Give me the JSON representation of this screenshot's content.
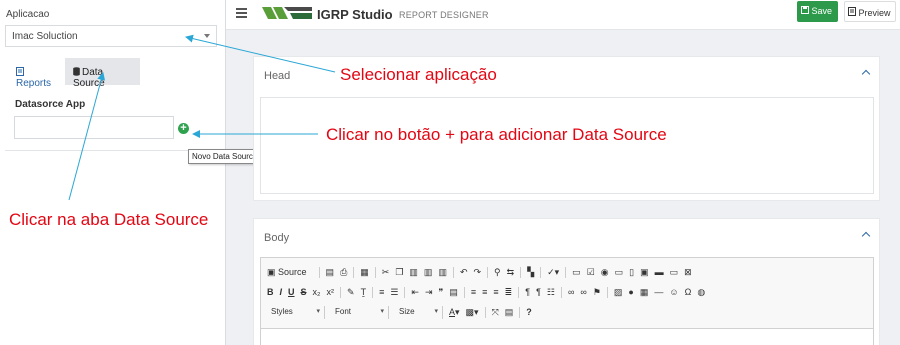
{
  "sidebar": {
    "app_label": "Aplicacao",
    "app_select_value": "Imac Soluction",
    "tabs": [
      {
        "label": "Reports"
      },
      {
        "label": "Data Source"
      }
    ],
    "datasource_label": "Datasorce App",
    "datasource_input_value": "",
    "add_tooltip": "Novo Data Source"
  },
  "topbar": {
    "brand": "IGRP Studio",
    "subtitle": "REPORT DESIGNER",
    "save_label": "Save",
    "preview_label": "Preview"
  },
  "head_panel": {
    "title": "Head"
  },
  "body_panel": {
    "title": "Body",
    "toolbar": {
      "source_label": "Source",
      "styles_label": "Styles",
      "font_label": "Font",
      "size_label": "Size"
    }
  },
  "annotations": {
    "select_app": "Selecionar aplicação",
    "click_add": "Clicar no botão + para adicionar Data Source",
    "click_tab": "Clicar na aba Data Source"
  },
  "colors": {
    "save_green": "#2c9a4a",
    "add_green": "#2fa24f",
    "annotation_red": "#e30613",
    "arrow_blue": "#2aa7d6",
    "link_blue": "#2a66a9"
  }
}
